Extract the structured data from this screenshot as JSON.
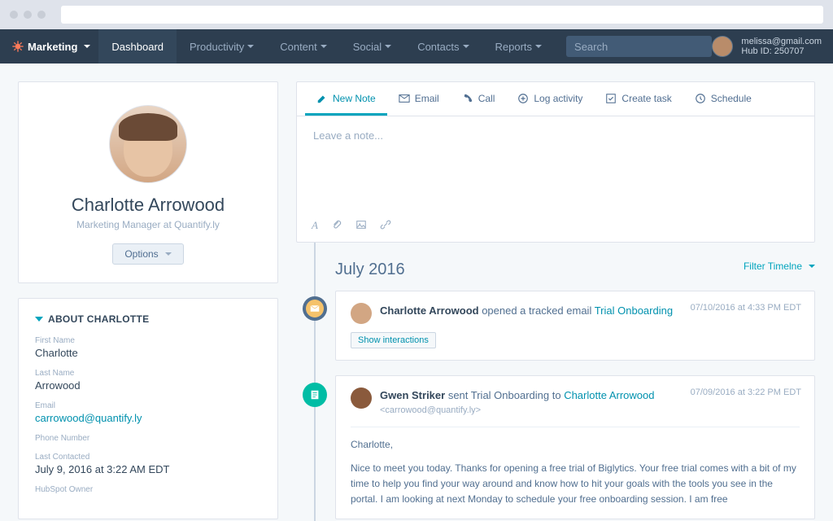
{
  "nav": {
    "brand": "Marketing",
    "items": [
      "Dashboard",
      "Productivity",
      "Content",
      "Social",
      "Contacts",
      "Reports"
    ],
    "active_index": 0,
    "search_placeholder": "Search",
    "user_email": "melissa@gmail.com",
    "hub_id_label": "Hub ID: 250707"
  },
  "profile": {
    "name": "Charlotte Arrowood",
    "subtitle": "Marketing Manager at Quantify.ly",
    "options_label": "Options"
  },
  "about": {
    "heading": "ABOUT CHARLOTTE",
    "fields": [
      {
        "label": "First Name",
        "value": "Charlotte",
        "link": false
      },
      {
        "label": "Last Name",
        "value": "Arrowood",
        "link": false
      },
      {
        "label": "Email",
        "value": "carrowood@quantify.ly",
        "link": true
      },
      {
        "label": "Phone Number",
        "value": "",
        "link": false
      },
      {
        "label": "Last Contacted",
        "value": "July 9, 2016 at 3:22 AM EDT",
        "link": false
      },
      {
        "label": "HubSpot Owner",
        "value": "",
        "link": false
      }
    ]
  },
  "composer": {
    "tabs": [
      {
        "label": "New Note",
        "icon": "pencil"
      },
      {
        "label": "Email",
        "icon": "envelope"
      },
      {
        "label": "Call",
        "icon": "phone"
      },
      {
        "label": "Log activity",
        "icon": "plus-circle"
      },
      {
        "label": "Create task",
        "icon": "check-square"
      },
      {
        "label": "Schedule",
        "icon": "clock"
      }
    ],
    "active_tab": 0,
    "placeholder": "Leave a note..."
  },
  "timeline": {
    "month": "July 2016",
    "filter_label": "Filter Timelne",
    "items": [
      {
        "kind": "mail",
        "actor": "Charlotte Arrowood",
        "verb": " opened a tracked email ",
        "link": "Trial Onboarding",
        "timestamp": "07/10/2016 at 4:33 PM EDT",
        "button": "Show interactions"
      },
      {
        "kind": "doc",
        "actor": "Gwen Striker",
        "verb": " sent Trial Onboarding to ",
        "link": "Charlotte Arrowood",
        "sub": "<carrowood@quantify.ly>",
        "timestamp": "07/09/2016 at 3:22 PM EDT",
        "salutation": "Charlotte,",
        "body": "Nice to meet you today.  Thanks for opening a free trial of Biglytics.  Your free trial comes with a bit of my time to help you find your way around and know how to hit your goals with the tools you see in the portal.  I am looking at next Monday to schedule your free onboarding session.  I am free"
      }
    ]
  }
}
